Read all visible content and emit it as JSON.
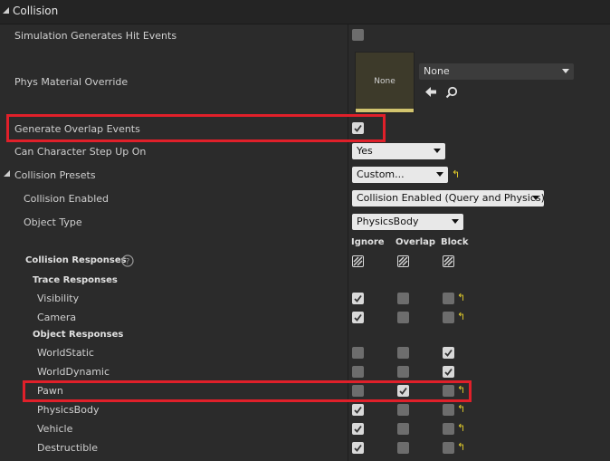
{
  "section": {
    "title": "Collision"
  },
  "rows": {
    "sim_hit": "Simulation Generates Hit Events",
    "phys_mat": "Phys Material Override",
    "gen_overlap": "Generate Overlap Events",
    "char_step": "Can Character Step Up On",
    "presets": "Collision Presets",
    "coll_enabled": "Collision Enabled",
    "object_type": "Object Type",
    "coll_responses": "Collision Responses",
    "trace_responses": "Trace Responses",
    "object_responses": "Object Responses"
  },
  "phys_material": {
    "thumb_text": "None",
    "combo_value": "None"
  },
  "combos": {
    "char_step": "Yes",
    "presets": "Custom...",
    "coll_enabled": "Collision Enabled (Query and Physics)",
    "object_type": "PhysicsBody"
  },
  "columns": {
    "ignore": "Ignore",
    "overlap": "Overlap",
    "block": "Block"
  },
  "trace_channels": [
    {
      "name": "Visibility",
      "ignore": true,
      "overlap": false,
      "block": false
    },
    {
      "name": "Camera",
      "ignore": true,
      "overlap": false,
      "block": false
    }
  ],
  "object_channels": [
    {
      "name": "WorldStatic",
      "ignore": false,
      "overlap": false,
      "block": true
    },
    {
      "name": "WorldDynamic",
      "ignore": false,
      "overlap": false,
      "block": true
    },
    {
      "name": "Pawn",
      "ignore": false,
      "overlap": true,
      "block": false
    },
    {
      "name": "PhysicsBody",
      "ignore": true,
      "overlap": false,
      "block": false
    },
    {
      "name": "Vehicle",
      "ignore": true,
      "overlap": false,
      "block": false
    },
    {
      "name": "Destructible",
      "ignore": true,
      "overlap": false,
      "block": false
    }
  ],
  "checkbox_states": {
    "sim_hit": false,
    "gen_overlap": true
  },
  "colors": {
    "highlight": "#e0202a",
    "reset_arrow": "#e6cf2a",
    "panel": "#2b2b2b"
  },
  "icons": {
    "reset": "reset-to-default-icon",
    "help": "help-icon",
    "use": "use-selected-arrow-icon",
    "browse": "browse-search-icon"
  }
}
